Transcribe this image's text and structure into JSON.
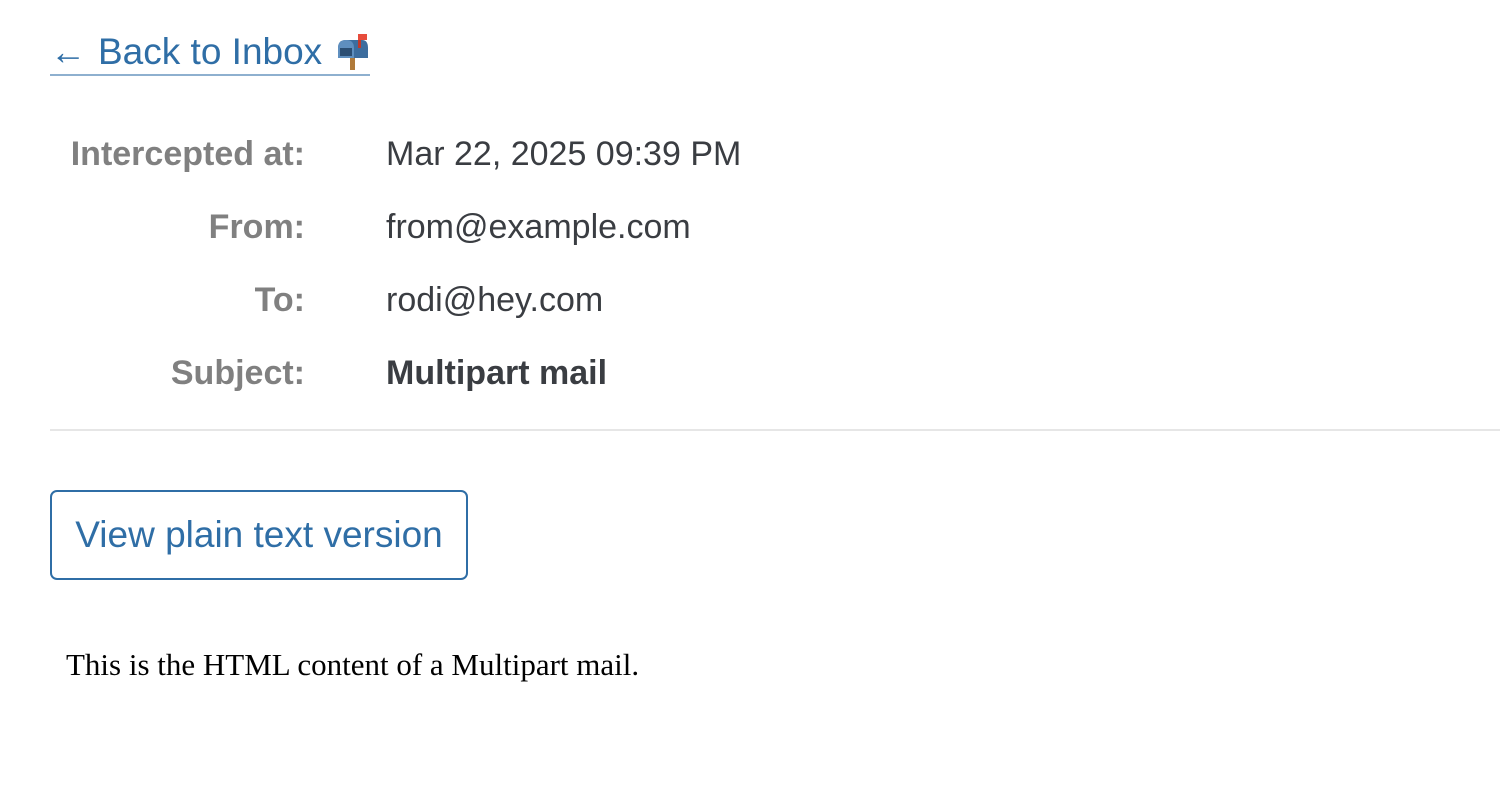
{
  "back_link": {
    "arrow": "←",
    "label": "Back to Inbox",
    "icon": "mailbox-icon"
  },
  "meta": {
    "intercepted_label": "Intercepted at:",
    "intercepted_value": "Mar 22, 2025 09:39 PM",
    "from_label": "From:",
    "from_value": "from@example.com",
    "to_label": "To:",
    "to_value": "rodi@hey.com",
    "subject_label": "Subject:",
    "subject_value": "Multipart mail"
  },
  "actions": {
    "plain_text_label": "View plain text version"
  },
  "body": {
    "html_content": "This is the HTML content of a Multipart mail."
  },
  "colors": {
    "link": "#2f6ea6",
    "label": "#808080",
    "value": "#3a3d42",
    "divider": "#e6e6e6"
  }
}
